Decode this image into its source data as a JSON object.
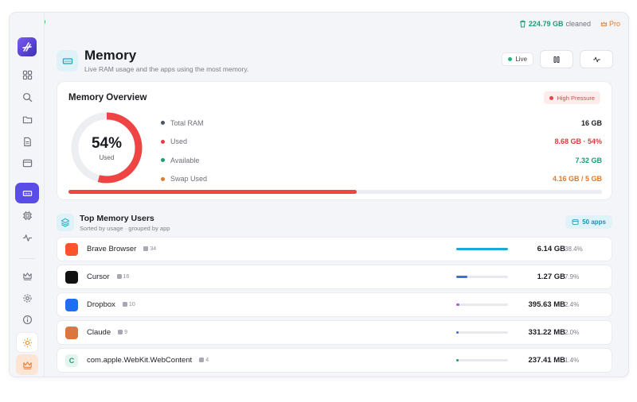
{
  "topbar": {
    "cleaned_value": "224.79 GB",
    "cleaned_label": "cleaned",
    "pro_label": "Pro"
  },
  "header": {
    "title": "Memory",
    "subtitle": "Live RAM usage and the apps using the most memory.",
    "live_label": "Live"
  },
  "overview": {
    "title": "Memory Overview",
    "pressure_label": "High Pressure",
    "percent_text": "54%",
    "percent_caption": "Used",
    "used_fraction": 0.54,
    "stats": [
      {
        "label": "Total RAM",
        "value": "16 GB",
        "color": "#4b5566",
        "value_color": "#1c1d22"
      },
      {
        "label": "Used",
        "value": "8.68 GB · 54%",
        "color": "#e53e3e",
        "value_color": "#d93b3b"
      },
      {
        "label": "Available",
        "value": "7.32 GB",
        "color": "#1e9c73",
        "value_color": "#1e9c73"
      },
      {
        "label": "Swap Used",
        "value": "4.16 GB / 5 GB",
        "color": "#e07a2c",
        "value_color": "#e07a2c"
      }
    ]
  },
  "top_users": {
    "title": "Top Memory Users",
    "subtitle": "Sorted by usage · grouped by app",
    "apps_badge": "50 apps",
    "rows": [
      {
        "icon": "brave-icon",
        "icon_glyph": "",
        "icon_color": "#fb542b",
        "name": "Brave Browser",
        "count": "34",
        "size": "6.14 GB",
        "percent": "38.4%",
        "usage": 1.0,
        "bar_color": "#1fa8d6"
      },
      {
        "icon": "cursor-icon",
        "icon_glyph": "",
        "icon_color": "#111111",
        "name": "Cursor",
        "count": "16",
        "size": "1.27 GB",
        "percent": "7.9%",
        "usage": 0.21,
        "bar_color": "#3b6fe0"
      },
      {
        "icon": "dropbox-icon",
        "icon_glyph": "",
        "icon_color": "#1f6ff2",
        "name": "Dropbox",
        "count": "10",
        "size": "395.63 MB",
        "percent": "2.4%",
        "usage": 0.06,
        "bar_color": "#b05be0"
      },
      {
        "icon": "claude-icon",
        "icon_glyph": "",
        "icon_color": "#d9773d",
        "name": "Claude",
        "count": "9",
        "size": "331.22 MB",
        "percent": "2.0%",
        "usage": 0.05,
        "bar_color": "#3b6fe0"
      },
      {
        "icon": "webkit-icon",
        "icon_glyph": "C",
        "icon_color": "#e3f5ee",
        "name": "com.apple.WebKit.WebContent",
        "count": "4",
        "size": "237.41 MB",
        "percent": "1.4%",
        "usage": 0.04,
        "bar_color": "#1e9c73"
      }
    ]
  }
}
